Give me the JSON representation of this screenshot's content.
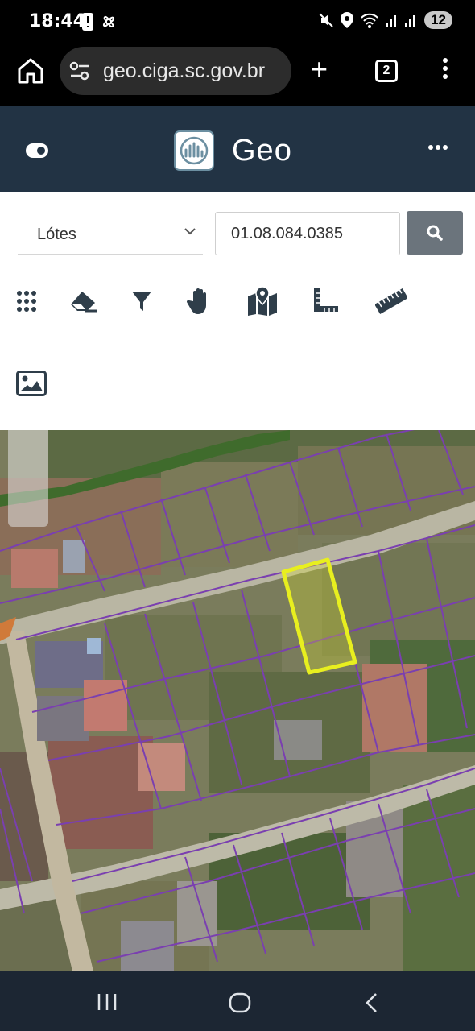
{
  "status_bar": {
    "time": "18:44",
    "notification_count": "12"
  },
  "browser": {
    "url": "geo.ciga.sc.gov.br",
    "tab_count": "2"
  },
  "app": {
    "title": "Geo"
  },
  "search": {
    "layer_select_value": "Lótes",
    "lot_number_value": "01.08.084.0385"
  },
  "toolbar": {
    "tools": [
      "apps-grid-icon",
      "eraser-icon",
      "filter-icon",
      "pan-hand-icon",
      "map-marker-icon",
      "measure-area-icon",
      "ruler-icon",
      "image-icon"
    ]
  },
  "colors": {
    "header": "#223344",
    "search_button": "#6b747c",
    "parcel_outline": "#7a3fb0",
    "selected_parcel": "#e8ef1f",
    "nav_bar": "#1c2633"
  }
}
